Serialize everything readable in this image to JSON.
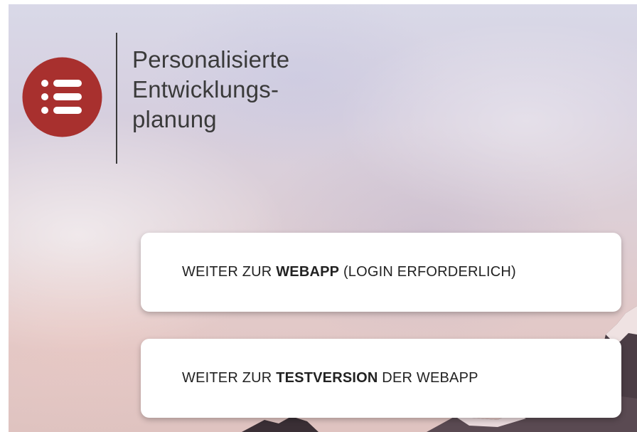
{
  "brand": {
    "logo_icon": "list-icon",
    "logo_color": "#a8302e",
    "title_lines": [
      "Personalisierte",
      "Entwicklungs-",
      "planung"
    ]
  },
  "actions": {
    "webapp": {
      "prefix": "WEITER ZUR ",
      "bold": "WEBAPP",
      "suffix": " (LOGIN ERFORDERLICH)"
    },
    "testversion": {
      "prefix": "WEITER ZUR ",
      "bold": "TESTVERSION",
      "suffix": " DER WEBAPP"
    }
  }
}
